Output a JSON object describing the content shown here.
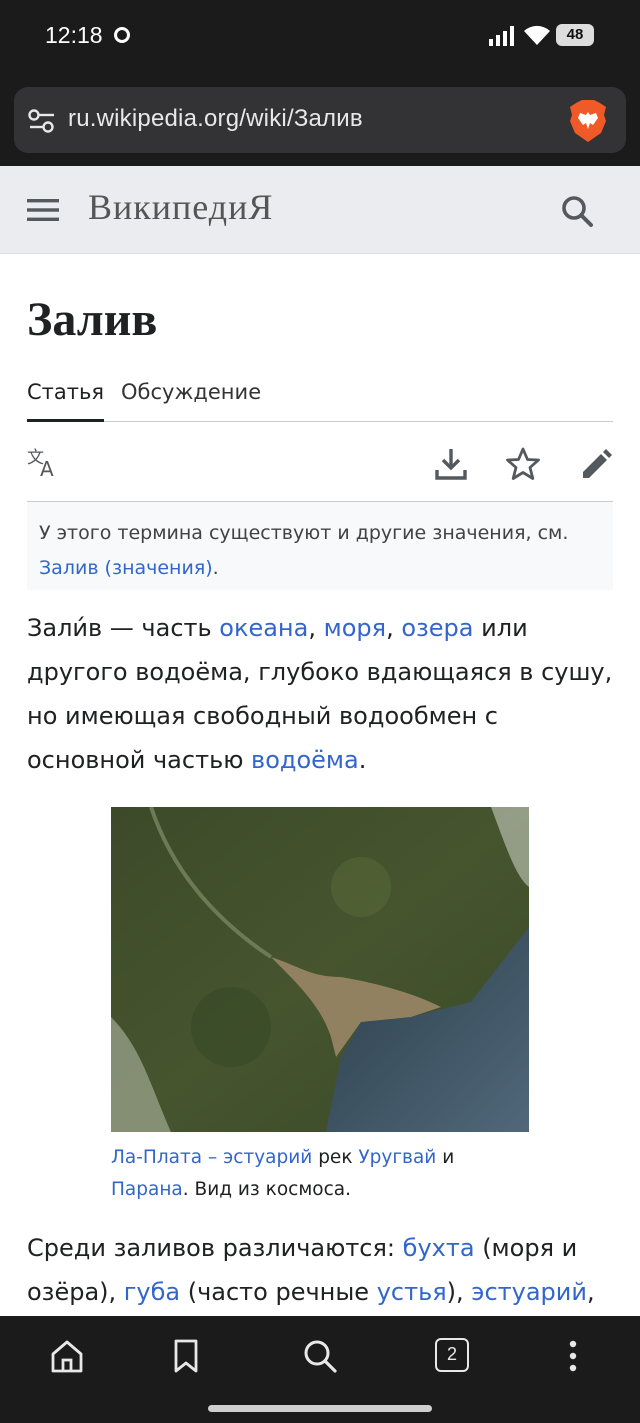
{
  "status_bar": {
    "time": "12:18",
    "battery": "48"
  },
  "browser": {
    "url": "ru.wikipedia.org/wiki/Залив"
  },
  "wiki_header": {
    "wordmark": "ВикипедиЯ"
  },
  "article": {
    "title": "Залив",
    "tabs": [
      {
        "label": "Статья",
        "active": true
      },
      {
        "label": "Обсуждение",
        "active": false
      }
    ],
    "hatnote": {
      "text": "У этого термина существуют и другие значения, см.",
      "link": "Залив (значения)",
      "end": "."
    },
    "lead": {
      "p1": "Зали́в — часть ",
      "l1": "океана",
      "p2": ", ",
      "l2": "моря",
      "p3": ", ",
      "l3": "озера",
      "p4": " или другого водоёма, глубоко вдающаяся в сушу, но имеющая свободный водообмен с основной частью ",
      "l4": "водоёма",
      "p5": "."
    },
    "figure_caption": {
      "l1": "Ла-Плата",
      "t1": " – ",
      "l2": "эстуарий",
      "t2": " рек ",
      "l3": "Уругвай",
      "t3": " и ",
      "l4": "Парана",
      "t4": ". Вид из космоса."
    },
    "second_para": {
      "t1": "Среди заливов различаются: ",
      "l1": "бухта",
      "t2": " (моря и озёра), ",
      "l2": "губа",
      "t3": " (часто речные ",
      "l3": "устья",
      "t4": "), ",
      "l4": "эстуарий",
      "t5": ","
    }
  },
  "bottom_nav": {
    "tab_count": "2"
  },
  "colors": {
    "link": "#3366cc",
    "chrome_bg": "#1b1b1b",
    "header_bg": "#eaecf0"
  }
}
